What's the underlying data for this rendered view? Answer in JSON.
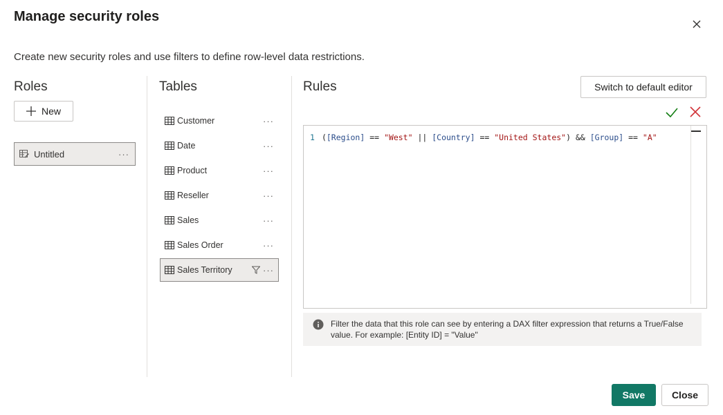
{
  "dialog": {
    "title": "Manage security roles",
    "subtitle": "Create new security roles and use filters to define row-level data restrictions."
  },
  "roles": {
    "header": "Roles",
    "new_label": "New",
    "items": [
      {
        "label": "Untitled",
        "more": "···"
      }
    ]
  },
  "tables": {
    "header": "Tables",
    "items": [
      {
        "label": "Customer",
        "more": "···"
      },
      {
        "label": "Date",
        "more": "···"
      },
      {
        "label": "Product",
        "more": "···"
      },
      {
        "label": "Reseller",
        "more": "···"
      },
      {
        "label": "Sales",
        "more": "···"
      },
      {
        "label": "Sales Order",
        "more": "···"
      },
      {
        "label": "Sales Territory",
        "more": "···",
        "selected": true,
        "filtered": true
      }
    ]
  },
  "rules": {
    "header": "Rules",
    "switch_label": "Switch to default editor",
    "line_number": "1",
    "code": {
      "p1": "(",
      "col_region": "[Region]",
      "op1": " == ",
      "str_west": "\"West\"",
      "op2": " || ",
      "col_country": "[Country]",
      "op3": " == ",
      "str_us": "\"United States\"",
      "p2": ") && ",
      "col_group": "[Group]",
      "op4": " == ",
      "str_a": "\"A\""
    },
    "info_text": "Filter the data that this role can see by entering a DAX filter expression that returns a True/False value. For example: [Entity ID] = \"Value\""
  },
  "footer": {
    "save_label": "Save",
    "close_label": "Close"
  },
  "colors": {
    "accent": "#117865",
    "check": "#107c10",
    "cancel": "#d13438"
  }
}
